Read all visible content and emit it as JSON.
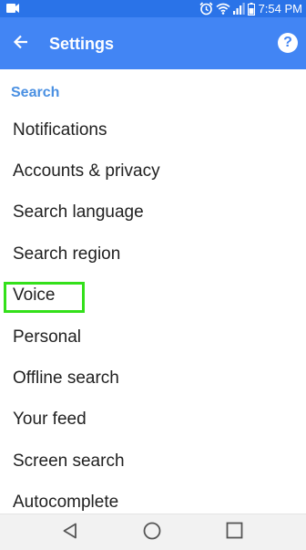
{
  "status_bar": {
    "time": "7:54 PM",
    "icons": [
      "notification-icon",
      "alarm-icon",
      "wifi-icon",
      "signal-icon",
      "battery-icon"
    ]
  },
  "app_bar": {
    "title": "Settings",
    "back_icon": "arrow-back-icon",
    "help_icon": "help-icon",
    "help_label": "?"
  },
  "section": {
    "header": "Search"
  },
  "settings": {
    "items": [
      {
        "label": "Notifications"
      },
      {
        "label": "Accounts & privacy"
      },
      {
        "label": "Search language"
      },
      {
        "label": "Search region"
      },
      {
        "label": "Voice"
      },
      {
        "label": "Personal"
      },
      {
        "label": "Offline search"
      },
      {
        "label": "Your feed"
      },
      {
        "label": "Screen search"
      },
      {
        "label": "Autocomplete"
      }
    ],
    "highlighted": "Voice"
  },
  "nav_bar": {
    "icons": [
      "back-triangle-icon",
      "home-circle-icon",
      "recents-square-icon"
    ]
  },
  "colors": {
    "status_bar": "#2a73e8",
    "app_bar": "#4285f4",
    "section_header": "#4a90e2",
    "highlight": "#33e01a",
    "nav_bar": "#f2f2f2"
  }
}
